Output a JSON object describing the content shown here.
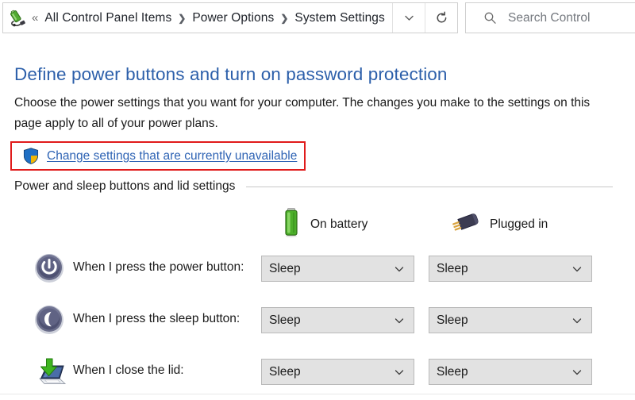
{
  "navbar": {
    "app_icon": "power-plug-battery-icon",
    "back_chevron": "«",
    "breadcrumbs": [
      {
        "label": "All Control Panel Items"
      },
      {
        "label": "Power Options"
      },
      {
        "label": "System Settings"
      }
    ],
    "crumb_separator": "❯",
    "history_dropdown_icon": "chevron-down-icon",
    "refresh_icon": "refresh-icon",
    "search": {
      "icon": "search-icon",
      "placeholder": "Search Control"
    }
  },
  "content": {
    "title": "Define power buttons and turn on password protection",
    "description": "Choose the power settings that you want for your computer. The changes you make to the settings on this page apply to all of your power plans.",
    "uac_link": {
      "icon": "uac-shield-icon",
      "label": "Change settings that are currently unavailable",
      "highlight_color": "#e01b1b"
    },
    "section": {
      "label": "Power and sleep buttons and lid settings"
    },
    "columns": [
      {
        "id": "battery",
        "icon": "battery-icon",
        "label": "On battery"
      },
      {
        "id": "plugged",
        "icon": "power-plug-icon",
        "label": "Plugged in"
      }
    ],
    "rows": [
      {
        "icon": "power-button-icon",
        "label": "When I press the power button:",
        "battery_value": "Sleep",
        "plugged_value": "Sleep"
      },
      {
        "icon": "sleep-button-icon",
        "label": "When I press the sleep button:",
        "battery_value": "Sleep",
        "plugged_value": "Sleep"
      },
      {
        "icon": "laptop-lid-icon",
        "label": "When I close the lid:",
        "battery_value": "Sleep",
        "plugged_value": "Sleep"
      }
    ]
  },
  "colors": {
    "title_blue": "#2c5faa",
    "link_blue": "#2e63b4",
    "highlight_red": "#e01b1b",
    "dropdown_bg": "#e2e2e2",
    "battery_green": "#4caf2a"
  }
}
